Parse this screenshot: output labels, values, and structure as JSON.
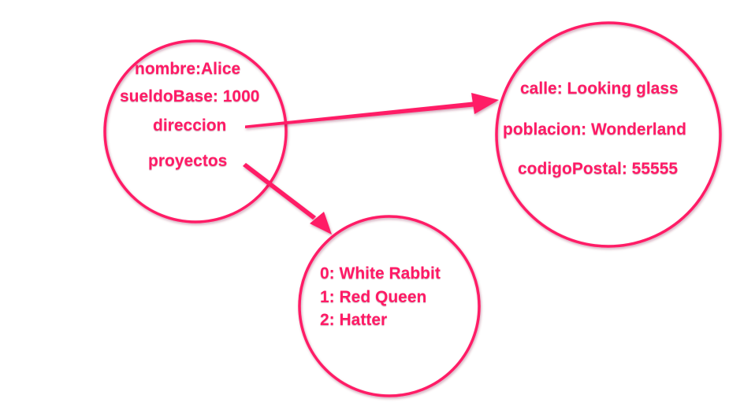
{
  "colors": {
    "accent": "#ff1a66",
    "background": "#ffffff"
  },
  "person": {
    "nombre": "nombre:Alice",
    "sueldoBase": "sueldoBase: 1000",
    "direccion": "direccion",
    "proyectos": "proyectos"
  },
  "direccion_node": {
    "calle": "calle: Looking glass",
    "poblacion": "poblacion: Wonderland",
    "codigoPostal": "codigoPostal: 55555"
  },
  "proyectos_node": {
    "items": [
      "0: White Rabbit",
      "1: Red Queen",
      "2: Hatter"
    ]
  },
  "arrows": [
    {
      "from": "direccion",
      "to": "direccion-node"
    },
    {
      "from": "proyectos",
      "to": "proyectos-node"
    }
  ]
}
